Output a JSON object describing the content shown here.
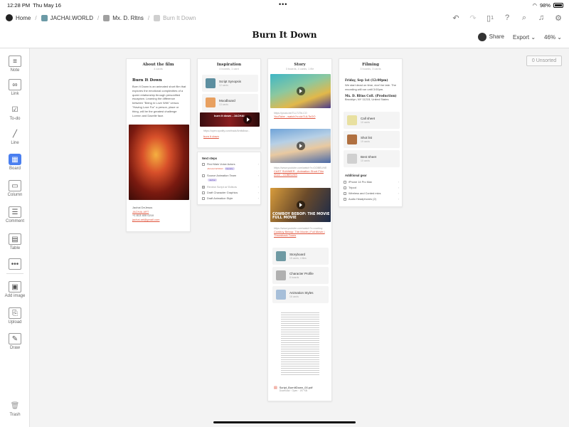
{
  "status": {
    "time": "12:28 PM",
    "date": "Thu May 16",
    "battery": "98%"
  },
  "breadcrumb": {
    "home": "Home",
    "items": [
      {
        "label": "JACHAI.WORLD",
        "color": "#6b9aa6"
      },
      {
        "label": "Mx. D. Rltns",
        "color": "#a0a0a0"
      },
      {
        "label": "Burn It Down",
        "color": "#cfcfcf"
      }
    ]
  },
  "header": {
    "title": "Burn It Down",
    "device_count": "1",
    "share": "Share",
    "export": "Export",
    "zoom": "46%"
  },
  "sidebar": {
    "items": [
      "Note",
      "Link",
      "To-do",
      "Line",
      "Board",
      "Column",
      "Comment",
      "Table",
      "",
      "Add image",
      "Upload",
      "Draw",
      "Trash"
    ]
  },
  "unsorted": "0 Unsorted",
  "columns": {
    "about": {
      "title": "About the film",
      "sub": "4 cards",
      "heading": "Burn It Down",
      "body": "Burn It Down is an animated short film that explores the emotional complexities of a queer relationship through personified escapism. Learning the difference between \"Being in Love With\" versus \"Having Love For\" a person, place or thing, will be the greatest challenge Lorenn and Dazelle face.",
      "contact_name": "Jachai DeJesus",
      "contact_link": "JACHAI.ART",
      "phone": "+1 813 400 0210",
      "email": "jachai.art@gmail.com"
    },
    "inspiration": {
      "title": "Inspiration",
      "sub": "4 boards, 1 card",
      "cards": [
        {
          "title": "Script Synopsis",
          "sub": "12 cards",
          "color": "#5d8fa0"
        },
        {
          "title": "Moodboard",
          "sub": "13 cards",
          "color": "#e8a060"
        }
      ],
      "video_title": "burn it down - JACHAI",
      "video_url": "https://open.spotify.com/track/4mfk8ww...",
      "video_link": "burn it down",
      "next_steps_title": "Next steps",
      "next_steps": [
        {
          "label": "Find Main Voice Actors",
          "done": false,
          "tags": [
            "JACHAI.WORLD",
            "Dazelle"
          ]
        },
        {
          "label": "Source Animation Team",
          "done": false,
          "tags": [
            "Jachai"
          ]
        },
        {
          "label": "Review Script w/ Editors",
          "done": true,
          "tags": []
        },
        {
          "label": "Draft Character Graphics",
          "done": false,
          "tags": []
        },
        {
          "label": "Draft Animation Style",
          "done": false,
          "tags": []
        }
      ]
    },
    "story": {
      "title": "Story",
      "sub": "3 boards, 4 cards, 1 file",
      "videos": [
        {
          "caption_url": "https://youtu.be/7LL7LTkl-CO",
          "caption": "YouTube - watch?v=dz7LiL7kOO"
        },
        {
          "caption_url": "https://www.youtube.com/watch?v=DOBELINE",
          "caption": "CAST SUMMER - Animation Short Film 2022 - GOBELINS"
        },
        {
          "caption_url": "https://www.youtube.com/watch?v=cowboy",
          "caption": "Cowboy Bebop: The Movie | Full Movie | Throwback Toons",
          "overlay": "COWBOY BEBOP: THE MOVIE FULL MOVIE"
        }
      ],
      "boards": [
        {
          "title": "Storyboard",
          "sub": "15 cards, 4 files",
          "color": "#6f9aa3"
        },
        {
          "title": "Character Profile",
          "sub": "8 boards",
          "color": "#b0b0b0"
        },
        {
          "title": "Animation Styles",
          "sub": "16 cards",
          "color": "#a7bfd9"
        }
      ],
      "file_name": "Script_BurnItDown_00.pdf",
      "file_meta": "Download · Open · 197 KB"
    },
    "filming": {
      "title": "Filming",
      "sub": "3 boards, 3 cards",
      "date": "Friday, Sep 1st (12:00pm)",
      "note": "We start dead on time, don't be late. The recording will run until 3:00pm.",
      "location_title": "Mx. D. Rltns Coll. (Production)",
      "location": "Brooklyn, NY 11215, United States",
      "cards": [
        {
          "title": "Call sheet",
          "sub": "10 cards",
          "color": "#e8e0a0"
        },
        {
          "title": "Shot list",
          "sub": "19 cards",
          "color": "#b07040"
        },
        {
          "title": "Best Sheet",
          "sub": "10 cards",
          "color": "#d0d0d0"
        }
      ],
      "gear_title": "Additional gear",
      "gear": [
        "iPhone 14 Pro Max",
        "Tripod",
        "Wireless and Corded mics",
        "Audio Headphones (2)"
      ]
    }
  }
}
